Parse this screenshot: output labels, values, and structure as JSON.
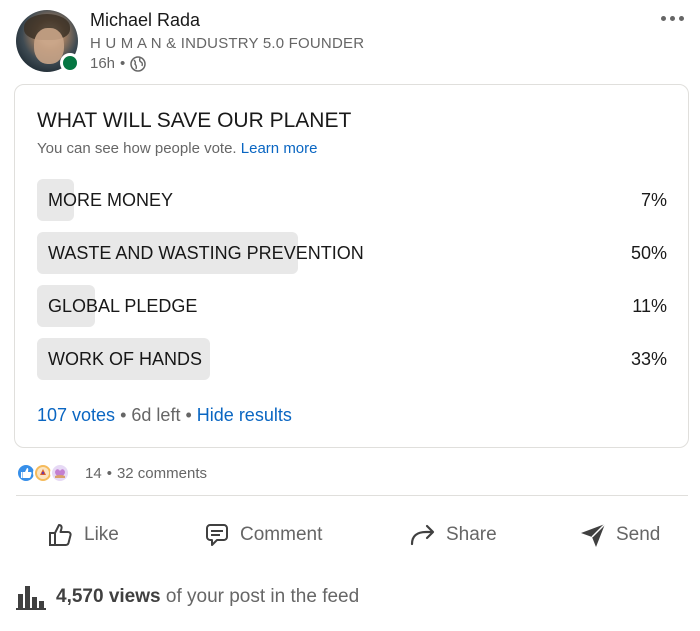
{
  "author": {
    "name": "Michael Rada",
    "headline": "H U M A N & INDUSTRY 5.0 FOUNDER",
    "time": "16h",
    "separator": "•"
  },
  "poll": {
    "question": "WHAT WILL SAVE OUR PLANET",
    "subtitle": "You can see how people vote.",
    "learn_more": "Learn more",
    "options": [
      {
        "label": "MORE MONEY",
        "percent_text": "7%",
        "percent": 7
      },
      {
        "label": "WASTE AND WASTING PREVENTION",
        "percent_text": "50%",
        "percent": 50
      },
      {
        "label": "GLOBAL PLEDGE",
        "percent_text": "11%",
        "percent": 11
      },
      {
        "label": "WORK OF HANDS",
        "percent_text": "33%",
        "percent": 33
      }
    ],
    "votes": "107 votes",
    "dot": "•",
    "time_left": "6d left",
    "hide_results": "Hide results"
  },
  "social": {
    "reactions": [
      "like-reaction-icon",
      "celebrate-reaction-icon",
      "support-reaction-icon"
    ],
    "reaction_count": "14",
    "dot": "•",
    "comments": "32 comments"
  },
  "actions": {
    "like": "Like",
    "comment": "Comment",
    "share": "Share",
    "send": "Send"
  },
  "views": {
    "count": "4,570 views",
    "suffix": "of your post in the feed"
  },
  "colors": {
    "link": "#0a66c2",
    "presence": "#057642",
    "bar": "#e8e8e8",
    "muted": "#666666"
  }
}
